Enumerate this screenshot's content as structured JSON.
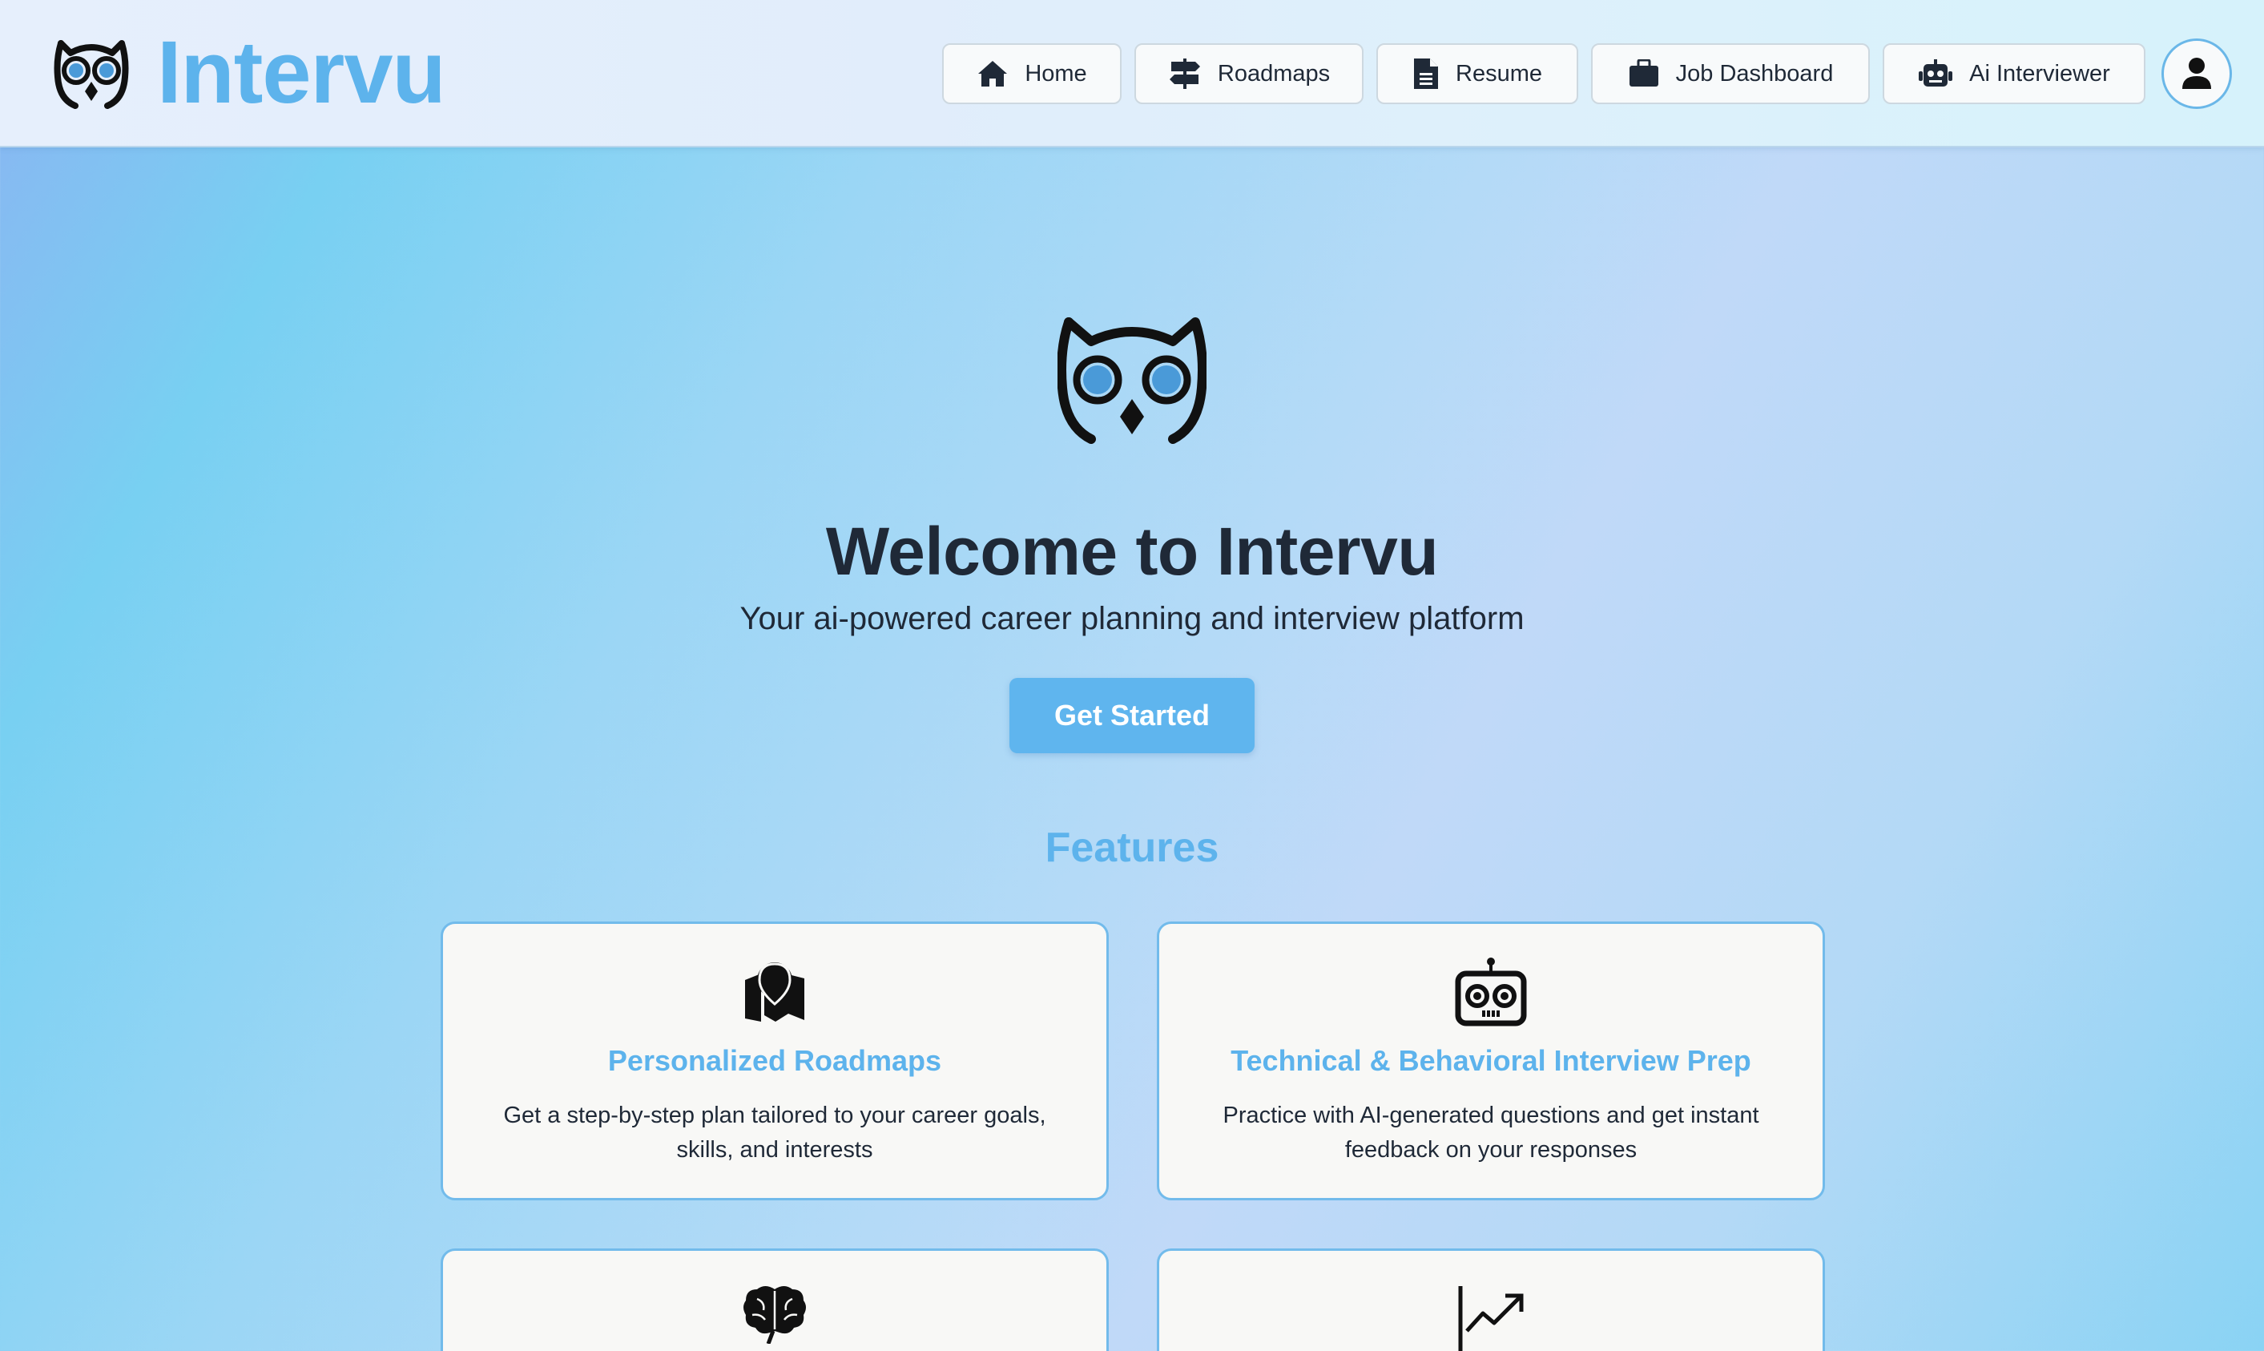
{
  "header": {
    "brand": "Intervu",
    "nav": [
      {
        "label": "Home",
        "icon": "home-icon"
      },
      {
        "label": "Roadmaps",
        "icon": "signpost-icon"
      },
      {
        "label": "Resume",
        "icon": "document-icon"
      },
      {
        "label": "Job Dashboard",
        "icon": "briefcase-icon"
      },
      {
        "label": "Ai Interviewer",
        "icon": "robot-icon"
      }
    ],
    "profile_icon": "user-icon"
  },
  "hero": {
    "title": "Welcome to Intervu",
    "subtitle": "Your ai-powered career planning and interview platform",
    "cta": "Get Started"
  },
  "features": {
    "title": "Features",
    "cards": [
      {
        "icon": "map-pin-icon",
        "title": "Personalized Roadmaps",
        "description": "Get a step-by-step plan tailored to your career goals, skills, and interests"
      },
      {
        "icon": "robot-face-icon",
        "title": "Technical & Behavioral Interview Prep",
        "description": "Practice with AI-generated questions and get instant feedback on your responses"
      },
      {
        "icon": "brain-icon",
        "title": "",
        "description": ""
      },
      {
        "icon": "chart-trend-icon",
        "title": "",
        "description": ""
      }
    ]
  },
  "colors": {
    "accent": "#5db3ec",
    "text": "#1f2937",
    "card_bg": "#f8f8f6",
    "card_border": "#72bbeb"
  }
}
